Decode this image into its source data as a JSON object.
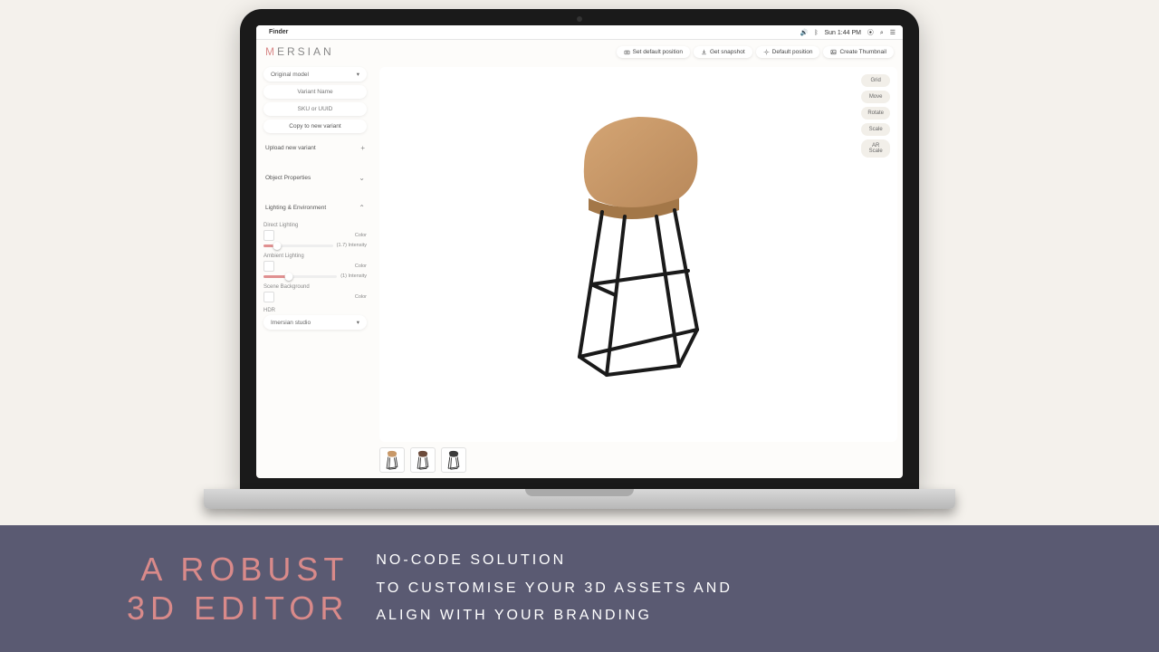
{
  "mac": {
    "finder": "Finder",
    "time": "Sun 1:44 PM"
  },
  "logo": {
    "first": "M",
    "rest": "ERSIAN"
  },
  "header_buttons": {
    "set_default": "Set default position",
    "snapshot": "Get snapshot",
    "default_pos": "Default position",
    "thumbnail": "Create Thumbnail"
  },
  "sidebar": {
    "model_select": "Original model",
    "variant_name_ph": "Variant Name",
    "sku_ph": "SKU or UUID",
    "copy_btn": "Copy to new variant",
    "upload_variant": "Upload new variant",
    "object_properties": "Object Properties",
    "lighting_env": "Lighting & Environment",
    "direct_lighting": "Direct Lighting",
    "ambient_lighting": "Ambient Lighting",
    "scene_background": "Scene Background",
    "hdr": "HDR",
    "color": "Color",
    "direct_intensity": "(1.7) Intensity",
    "ambient_intensity": "(1) Intensity",
    "hdr_select": "Imersian studio"
  },
  "tools": {
    "grid": "Grid",
    "move": "Move",
    "rotate": "Rotate",
    "scale": "Scale",
    "ar_scale1": "AR",
    "ar_scale2": "Scale"
  },
  "banner": {
    "headline1": "A ROBUST",
    "headline2": "3D EDITOR",
    "sub1": "NO-CODE SOLUTION",
    "sub2": "TO CUSTOMISE YOUR 3D ASSETS AND",
    "sub3": "ALIGN WITH YOUR BRANDING"
  },
  "variant_count": 3,
  "colors": {
    "accent": "#d98a8a",
    "banner_bg": "#5a5a72"
  }
}
